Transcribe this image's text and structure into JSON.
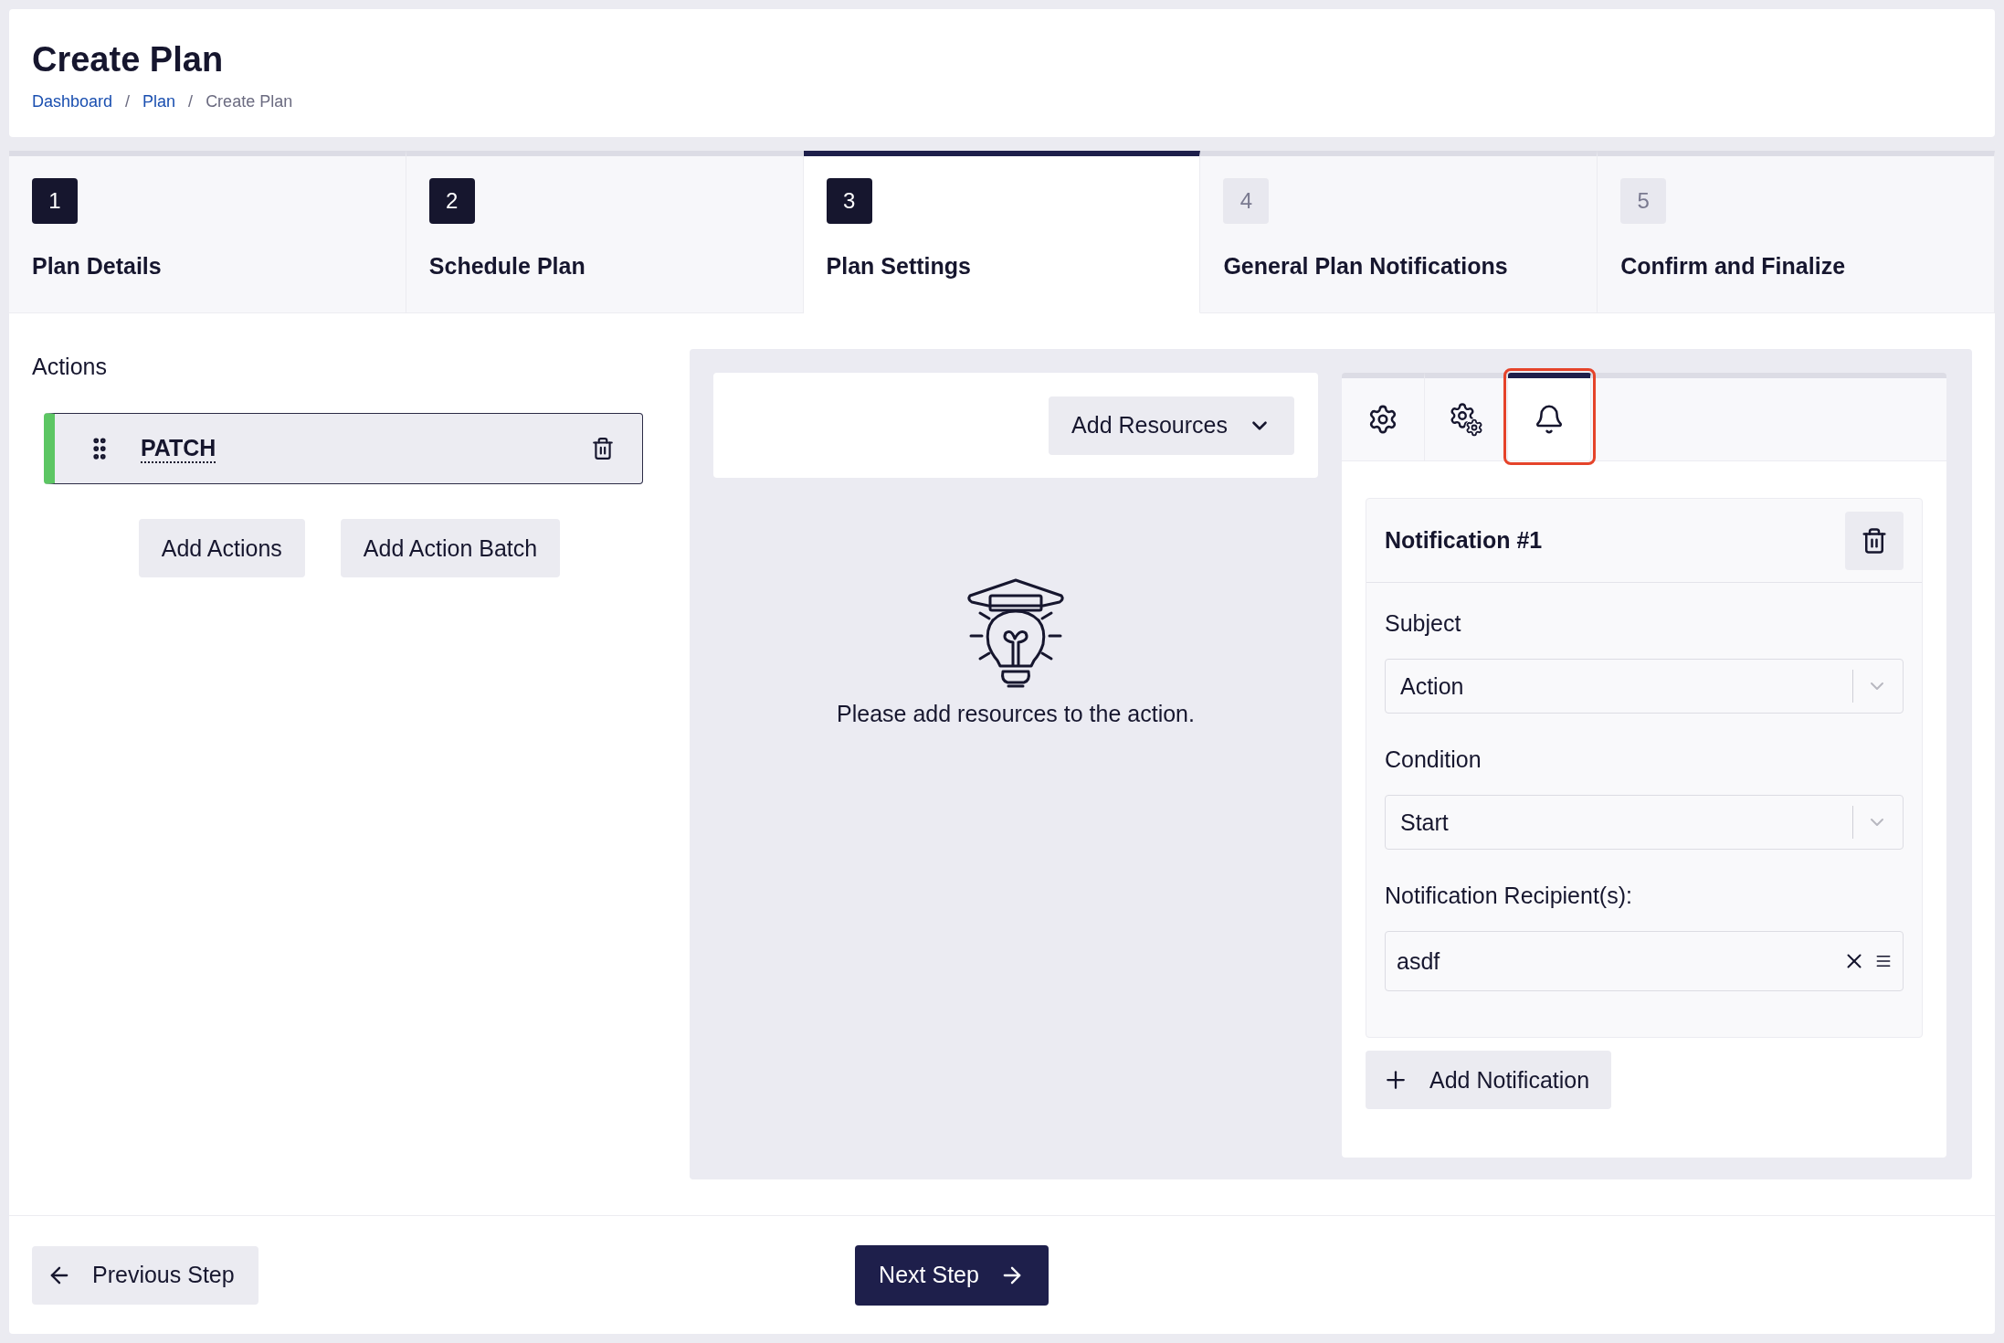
{
  "page": {
    "title": "Create Plan",
    "breadcrumbs": [
      {
        "label": "Dashboard",
        "current": false
      },
      {
        "label": "Plan",
        "current": false
      },
      {
        "label": "Create Plan",
        "current": true
      }
    ],
    "separator": "/"
  },
  "steps": [
    {
      "number": "1",
      "label": "Plan Details",
      "selected": false,
      "completed": true
    },
    {
      "number": "2",
      "label": "Schedule Plan",
      "selected": false,
      "completed": true
    },
    {
      "number": "3",
      "label": "Plan Settings",
      "selected": true,
      "completed": true
    },
    {
      "number": "4",
      "label": "General Plan Notifications",
      "selected": false,
      "completed": false
    },
    {
      "number": "5",
      "label": "Confirm and Finalize",
      "selected": false,
      "completed": false
    }
  ],
  "actions": {
    "title": "Actions",
    "items": [
      {
        "name": "PATCH",
        "color": "#5cc663"
      }
    ],
    "buttons": [
      "Add Actions",
      "Add Action Batch"
    ]
  },
  "resources": {
    "button": "Add Resources",
    "empty_message": "Please add resources to the action."
  },
  "settings_tabs": [
    {
      "kind": "settings",
      "selected": false,
      "highlighted": false
    },
    {
      "kind": "advanced",
      "selected": false,
      "highlighted": false
    },
    {
      "kind": "notifications",
      "selected": true,
      "highlighted": true
    }
  ],
  "notifications": [
    {
      "title": "Notification #1",
      "fields": [
        {
          "kind": "select",
          "label": "Subject",
          "value": "Action"
        },
        {
          "kind": "select",
          "label": "Condition",
          "value": "Start"
        },
        {
          "kind": "multi",
          "label": "Notification Recipient(s):",
          "value": "asdf"
        }
      ]
    }
  ],
  "add_notification": "Add Notification",
  "footer": {
    "previous": "Previous Step",
    "next": "Next Step"
  }
}
